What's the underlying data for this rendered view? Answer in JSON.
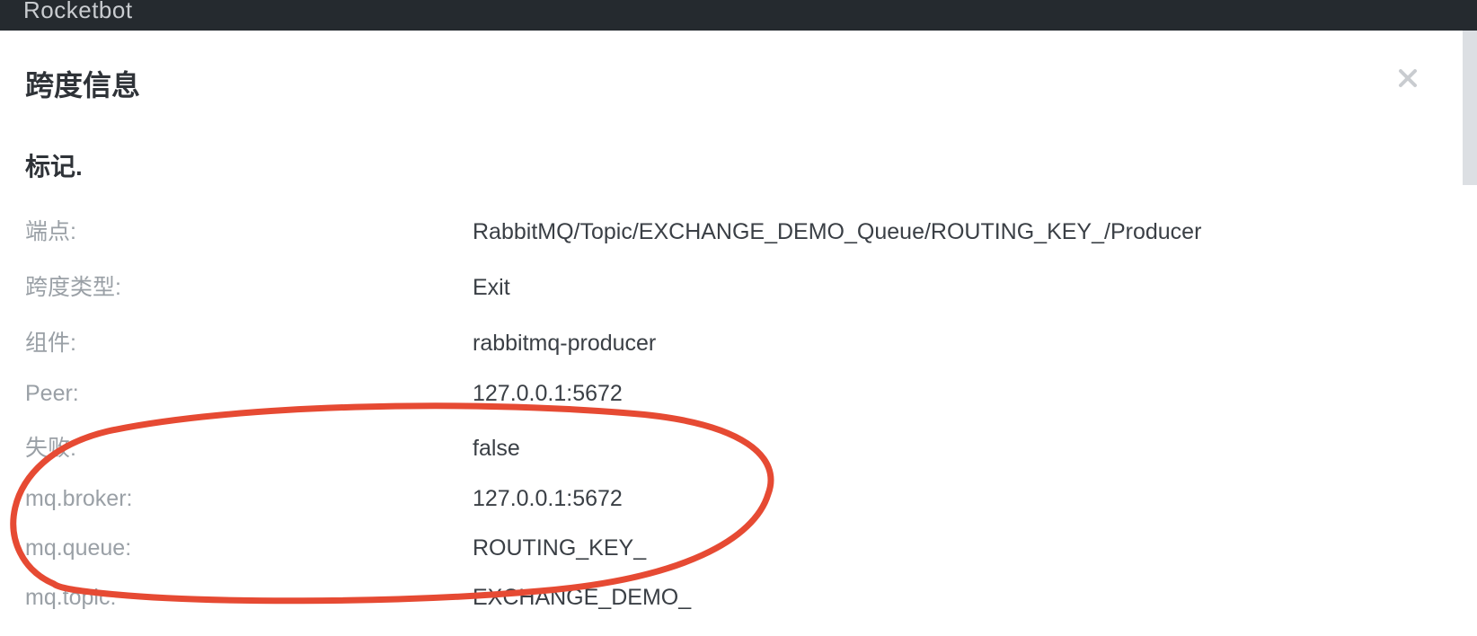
{
  "header": {
    "brand": "Rocketbot"
  },
  "panel": {
    "title": "跨度信息",
    "section_title": "标记.",
    "rows": [
      {
        "label": "端点:",
        "value": "RabbitMQ/Topic/EXCHANGE_DEMO_Queue/ROUTING_KEY_/Producer"
      },
      {
        "label": "跨度类型:",
        "value": "Exit"
      },
      {
        "label": "组件:",
        "value": "rabbitmq-producer"
      },
      {
        "label": "Peer:",
        "value": "127.0.0.1:5672"
      },
      {
        "label": "失败:",
        "value": "false"
      },
      {
        "label": "mq.broker:",
        "value": "127.0.0.1:5672"
      },
      {
        "label": "mq.queue:",
        "value": "ROUTING_KEY_"
      },
      {
        "label": "mq.topic:",
        "value": "EXCHANGE_DEMO_"
      }
    ]
  }
}
